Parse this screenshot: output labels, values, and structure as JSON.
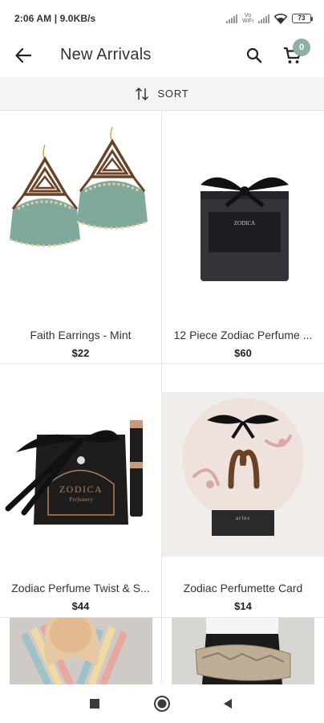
{
  "status_bar": {
    "time_speed": "2:06 AM | 9.0KB/s",
    "vowifi": "Vo\nWiFi",
    "battery": "73"
  },
  "app_bar": {
    "title": "New Arrivals",
    "cart_count": "0",
    "icons": {
      "back": "arrow-back-icon",
      "search": "search-icon",
      "cart": "cart-icon"
    }
  },
  "sort": {
    "label": "SORT",
    "icon": "sort-icon"
  },
  "products": [
    {
      "name": "Faith Earrings - Mint",
      "price": "$22"
    },
    {
      "name": "12 Piece Zodiac Perfume ...",
      "price": "$60"
    },
    {
      "name": "Zodiac Perfume Twist & S...",
      "price": "$44"
    },
    {
      "name": "Zodiac Perfumette Card",
      "price": "$14"
    }
  ],
  "brand_text": {
    "box_brand": "ZODICA",
    "box_subtitle": "Perfumery",
    "card_sign": "aries"
  },
  "colors": {
    "accent": "#8fb0a8",
    "tassel": "#7fa99b",
    "wood": "#6b4226"
  },
  "navigation": {
    "square": "recent-apps-icon",
    "circle": "home-icon",
    "triangle": "back-nav-icon"
  }
}
